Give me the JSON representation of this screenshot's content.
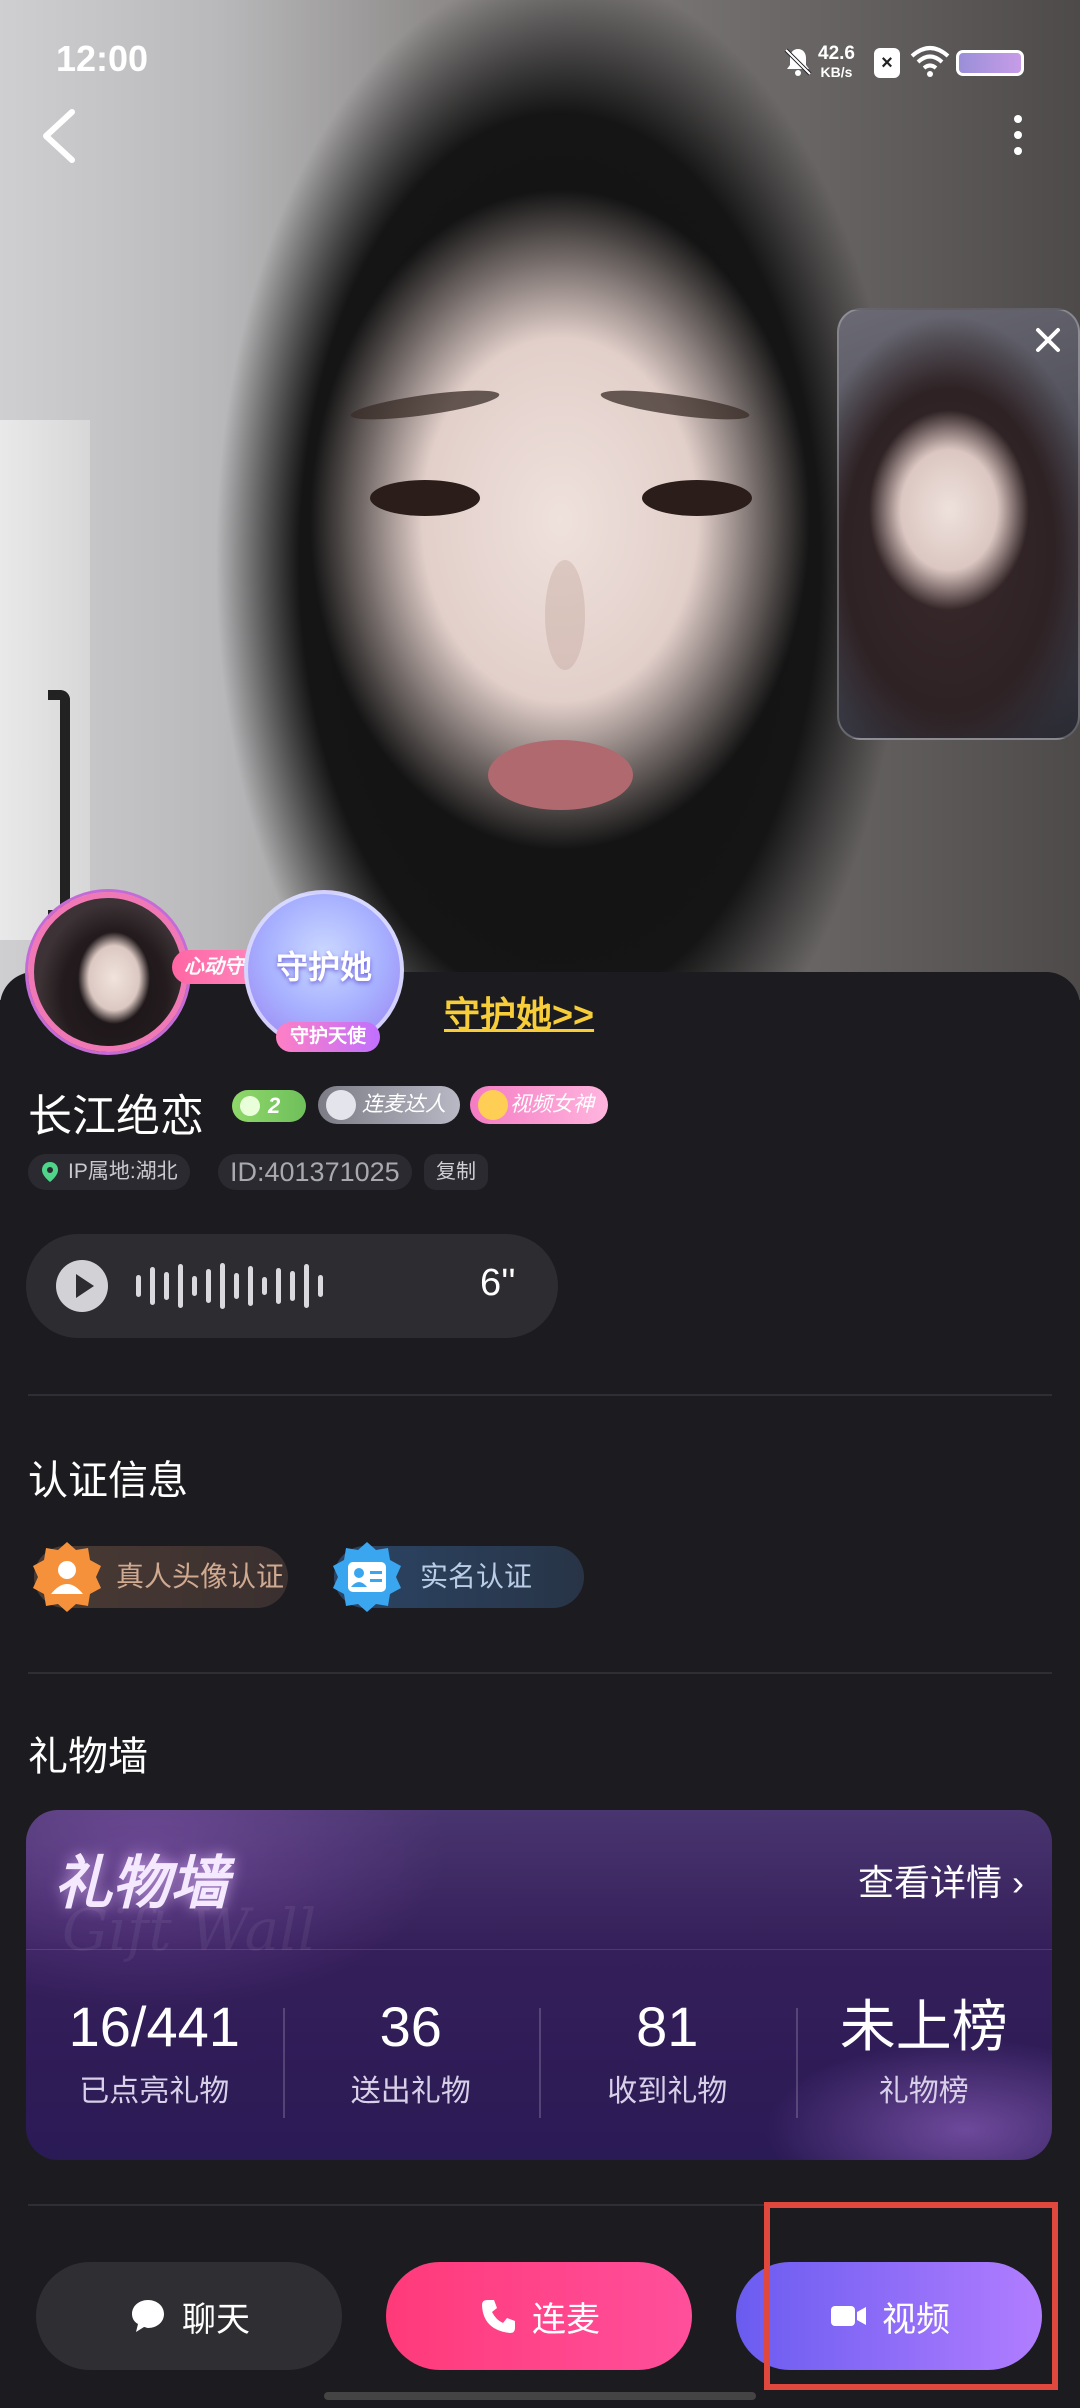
{
  "status_bar": {
    "time": "12:00",
    "net_speed_value": "42.6",
    "net_speed_unit": "KB/s"
  },
  "profile": {
    "name": "长江绝恋",
    "level": "2",
    "medals": [
      "连麦达人",
      "视频女神"
    ],
    "heart_tag": "心动守护",
    "guard_badge": {
      "title": "守护她",
      "ribbon": "守护天使"
    },
    "guard_link": "守护她>>",
    "ip": "IP属地:湖北",
    "id": "ID:401371025",
    "copy_label": "复制",
    "voice_duration": "6''"
  },
  "certification": {
    "title": "认证信息",
    "items": [
      {
        "label": "真人头像认证",
        "icon": "person-badge-icon",
        "color": "#f5913a"
      },
      {
        "label": "实名认证",
        "icon": "id-card-icon",
        "color": "#3aa6f0"
      }
    ]
  },
  "gift_wall": {
    "section_title": "礼物墙",
    "logo": "礼物墙",
    "logo_ghost": "Gift Wall",
    "detail_label": "查看详情",
    "stats": [
      {
        "value": "16/441",
        "label": "已点亮礼物"
      },
      {
        "value": "36",
        "label": "送出礼物"
      },
      {
        "value": "81",
        "label": "收到礼物"
      },
      {
        "value": "未上榜",
        "label": "礼物榜"
      }
    ]
  },
  "actions": {
    "chat": "聊天",
    "mic": "连麦",
    "video": "视频"
  },
  "colors": {
    "accent_pink": "#ff3a7a",
    "accent_purple": "#8a6cf6",
    "guard_link": "#f7cd3a",
    "highlight": "#e0483d"
  }
}
